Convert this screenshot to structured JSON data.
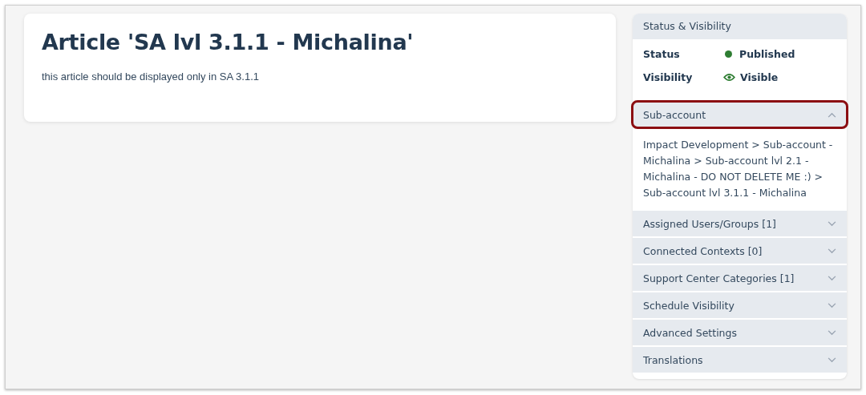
{
  "article": {
    "title": "Article 'SA lvl 3.1.1 - Michalina'",
    "body": "this article should be displayed only in SA 3.1.1"
  },
  "sidebar": {
    "header": "Status & Visibility",
    "fields": [
      {
        "label": "Status",
        "value": "Published",
        "kind": "dot",
        "color": "#2e7d32"
      },
      {
        "label": "Visibility",
        "value": "Visible",
        "kind": "eye",
        "color": "#2e7d32"
      }
    ],
    "sections": [
      {
        "title": "Sub-account",
        "expanded": true,
        "highlighted": true,
        "content": "Impact Development > Sub-account - Michalina > Sub-account lvl 2.1 - Michalina - DO NOT DELETE ME :) > Sub-account lvl 3.1.1 - Michalina"
      },
      {
        "title": "Assigned Users/Groups [1]",
        "expanded": false,
        "highlighted": false
      },
      {
        "title": "Connected Contexts [0]",
        "expanded": false,
        "highlighted": false
      },
      {
        "title": "Support Center Categories [1]",
        "expanded": false,
        "highlighted": false
      },
      {
        "title": "Schedule Visibility",
        "expanded": false,
        "highlighted": false
      },
      {
        "title": "Advanced Settings",
        "expanded": false,
        "highlighted": false
      },
      {
        "title": "Translations",
        "expanded": false,
        "highlighted": false
      }
    ]
  }
}
